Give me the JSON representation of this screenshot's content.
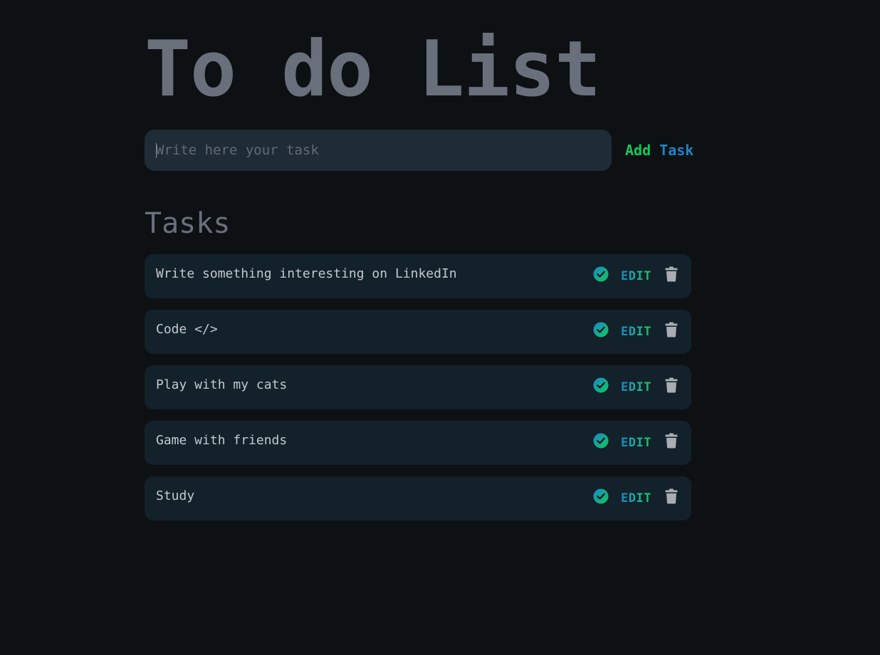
{
  "header": {
    "title": "To do List"
  },
  "new_task": {
    "placeholder": "Write here your task",
    "value": "",
    "add_button": {
      "word1": "Add",
      "word2": "Task"
    }
  },
  "tasks_section": {
    "heading": "Tasks",
    "items": [
      {
        "text": "Write something interesting on LinkedIn",
        "edit_label": "EDIT",
        "complete_icon": "check-circle-icon",
        "delete_icon": "trash-icon"
      },
      {
        "text": "Code </>",
        "edit_label": "EDIT",
        "complete_icon": "check-circle-icon",
        "delete_icon": "trash-icon"
      },
      {
        "text": "Play with my cats",
        "edit_label": "EDIT",
        "complete_icon": "check-circle-icon",
        "delete_icon": "trash-icon"
      },
      {
        "text": "Game with friends",
        "edit_label": "EDIT",
        "complete_icon": "check-circle-icon",
        "delete_icon": "trash-icon"
      },
      {
        "text": "Study",
        "edit_label": "EDIT",
        "complete_icon": "check-circle-icon",
        "delete_icon": "trash-icon"
      }
    ]
  },
  "colors": {
    "background": "#0e1113",
    "title": "#69707c",
    "input_bg": "#1f2b35",
    "task_bg": "#13212a",
    "accent_green": "#12c95a",
    "accent_blue": "#1a86cc",
    "trash": "#a9adb3"
  }
}
